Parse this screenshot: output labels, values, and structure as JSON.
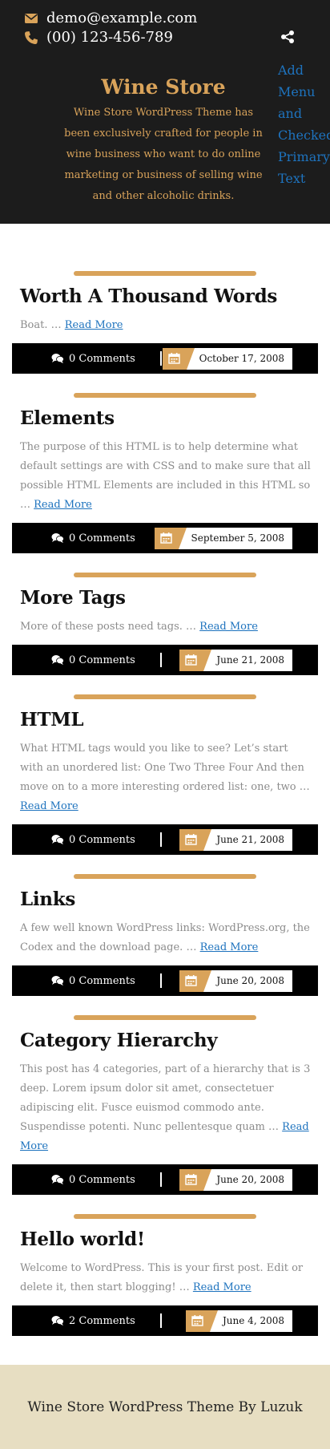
{
  "header": {
    "email": "demo@example.com",
    "phone": "(00) 123-456-789",
    "site_title": "Wine Store",
    "site_description": "Wine Store WordPress Theme has been exclusively crafted for people in wine business who want to do online marketing or business of selling wine and other alcoholic drinks.",
    "menu_fallback": "Add Menu and Checked Primary Text",
    "icons": {
      "email": "envelope-icon",
      "phone": "phone-icon",
      "share": "share-icon"
    },
    "colors": {
      "background": "#1c1c1c",
      "accent": "#d9a35a",
      "link": "#1e73be"
    }
  },
  "posts": [
    {
      "title": "Worth A Thousand Words",
      "excerpt": "Boat. …",
      "read_more": "Read More",
      "comments": "0 Comments",
      "date": "October 17, 2008"
    },
    {
      "title": "Elements",
      "excerpt": "The purpose of this HTML is to help determine what default settings are with CSS and to make sure that all possible HTML Elements are included in this HTML so …",
      "read_more": "Read More",
      "comments": "0 Comments",
      "date": "September 5, 2008"
    },
    {
      "title": "More Tags",
      "excerpt": "More of these posts need tags. …",
      "read_more": "Read More",
      "comments": "0 Comments",
      "date": "June 21, 2008"
    },
    {
      "title": "HTML",
      "excerpt": "What HTML tags would you like to see? Let’s start with an unordered list: One Two Three Four And then move on to a more interesting ordered list: one, two …",
      "read_more": "Read More",
      "comments": "0 Comments",
      "date": "June 21, 2008"
    },
    {
      "title": "Links",
      "excerpt": "A few well known WordPress links: WordPress.org, the Codex and the download page. …",
      "read_more": "Read More",
      "comments": "0 Comments",
      "date": "June 20, 2008"
    },
    {
      "title": "Category Hierarchy",
      "excerpt": "This post has 4 categories, part of a hierarchy that is 3 deep. Lorem ipsum dolor sit amet, consectetuer adipiscing elit. Fusce euismod commodo ante. Suspendisse potenti. Nunc pellentesque quam …",
      "read_more": "Read More",
      "comments": "0 Comments",
      "date": "June 20, 2008"
    },
    {
      "title": "Hello world!",
      "excerpt": "Welcome to WordPress. This is your first post. Edit or delete it, then start blogging! …",
      "read_more": "Read More",
      "comments": "2 Comments",
      "date": "June 4, 2008"
    }
  ],
  "footer": {
    "text": "Wine Store WordPress Theme By Luzuk",
    "background": "#e7dec2"
  }
}
